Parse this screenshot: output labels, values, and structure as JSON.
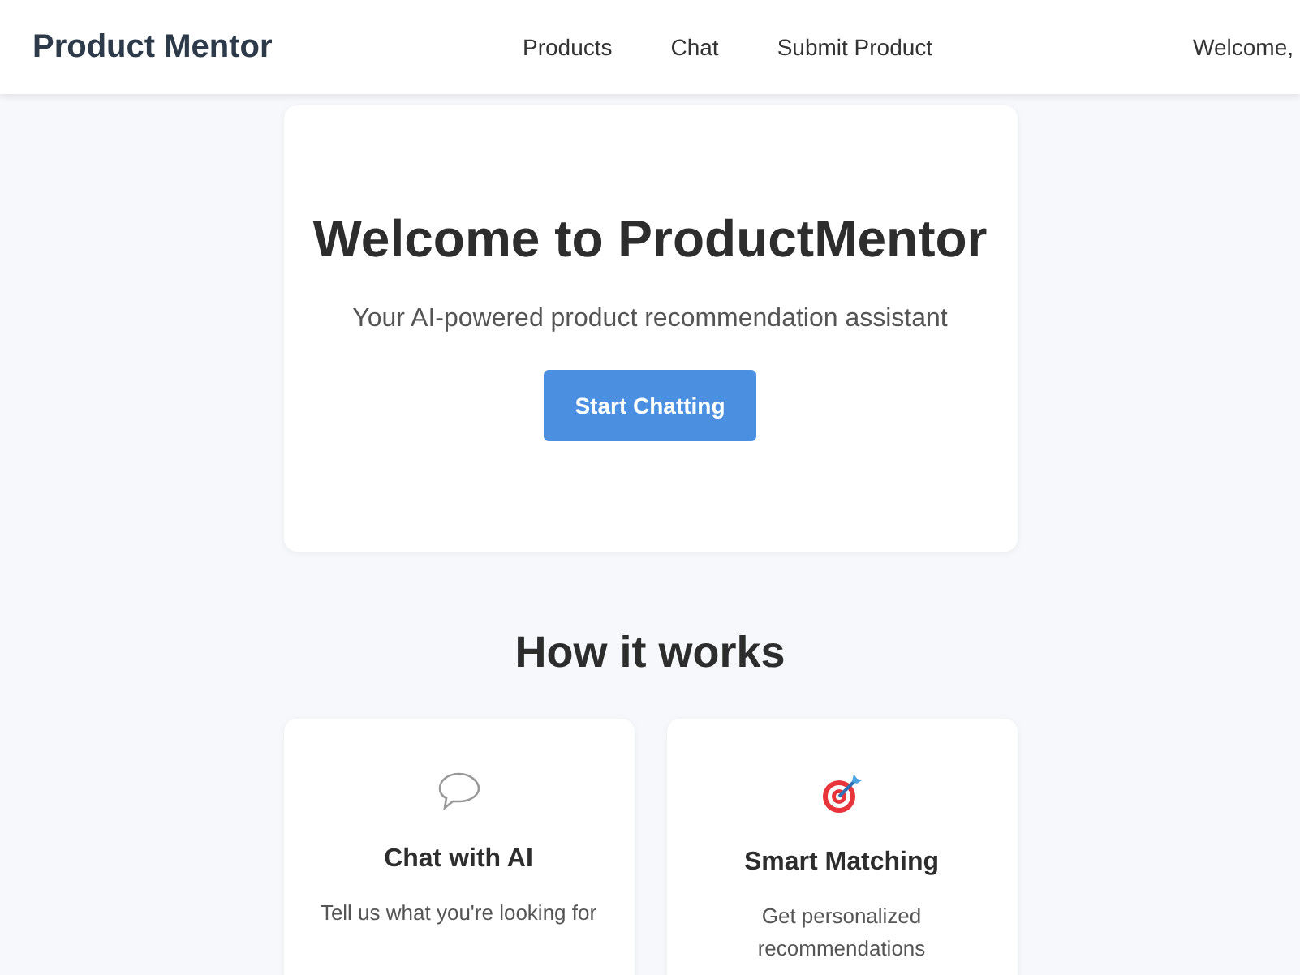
{
  "header": {
    "brand": "Product Mentor",
    "nav": [
      {
        "label": "Products"
      },
      {
        "label": "Chat"
      },
      {
        "label": "Submit Product"
      }
    ],
    "welcome": "Welcome,"
  },
  "hero": {
    "title": "Welcome to ProductMentor",
    "subtitle": "Your AI-powered product recommendation assistant",
    "button": "Start Chatting"
  },
  "how_it_works": {
    "title": "How it works",
    "cards": [
      {
        "kind": "chat",
        "title": "Chat with AI",
        "text": "Tell us what you're looking for"
      },
      {
        "kind": "target",
        "title": "Smart Matching",
        "text": "Get personalized recommendations"
      }
    ]
  }
}
